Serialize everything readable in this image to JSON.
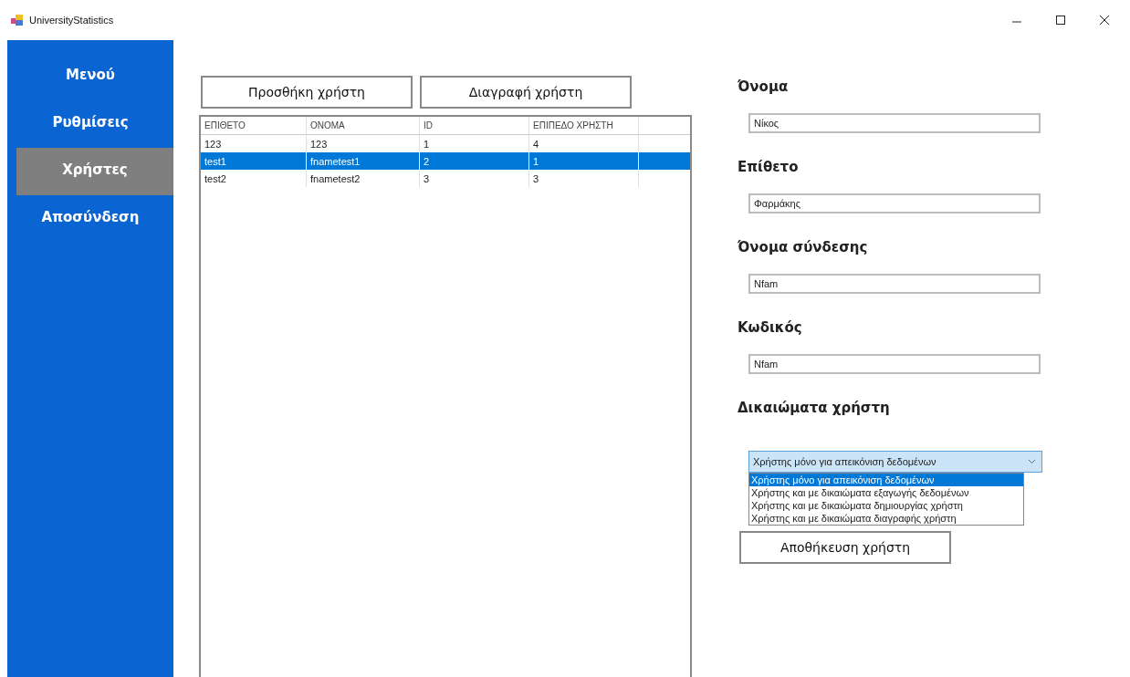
{
  "window": {
    "title": "UniversityStatistics"
  },
  "sidebar": {
    "items": [
      {
        "label": "Μενού",
        "selected": false
      },
      {
        "label": "Ρυθμίσεις",
        "selected": false
      },
      {
        "label": "Χρήστες",
        "selected": true
      },
      {
        "label": "Αποσύνδεση",
        "selected": false
      }
    ]
  },
  "toolbar": {
    "buttons": [
      "Προσθήκη χρήστη",
      "Διαγραφή χρήστη"
    ]
  },
  "table": {
    "columns": [
      "ΕΠΙΘΕΤΟ",
      "ΟΝΟΜΑ",
      "ID",
      "ΕΠΙΠΕΔΟ ΧΡΗΣΤΗ"
    ],
    "rows": [
      {
        "cells": [
          "123",
          "123",
          "1",
          "4"
        ],
        "selected": false
      },
      {
        "cells": [
          "test1",
          "fnametest1",
          "2",
          "1"
        ],
        "selected": true
      },
      {
        "cells": [
          "test2",
          "fnametest2",
          "3",
          "3"
        ],
        "selected": false
      }
    ]
  },
  "form": {
    "fields": [
      {
        "label": "Όνομα",
        "value": "Νίκος"
      },
      {
        "label": "Επίθετο",
        "value": "Φαρμάκης"
      },
      {
        "label": "Όνομα σύνδεσης",
        "value": "Nfam"
      },
      {
        "label": "Κωδικός",
        "value": "Nfam"
      }
    ],
    "permissions": {
      "label": "Δικαιώματα χρήστη",
      "value": "Χρήστης μόνο για απεικόνιση δεδομένων",
      "expanded": true,
      "options": [
        {
          "label": "Χρήστης μόνο για απεικόνιση δεδομένων",
          "selected": true
        },
        {
          "label": "Χρήστης και με δικαιώματα εξαγωγής δεδομένων",
          "selected": false
        },
        {
          "label": "Χρήστης και με δικαιώματα δημιουργίας χρήστη",
          "selected": false
        },
        {
          "label": "Χρήστης και με δικαιώματα διαγραφής χρήστη",
          "selected": false
        }
      ]
    },
    "save_button": "Αποθήκευση χρήστη"
  }
}
